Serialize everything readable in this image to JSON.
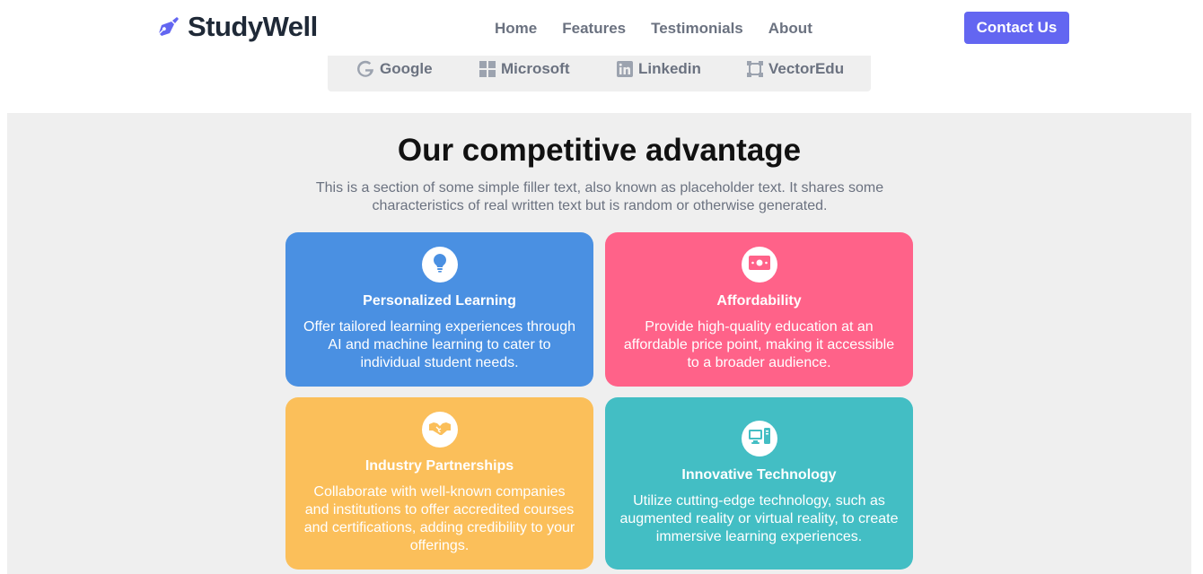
{
  "header": {
    "logo_text": "StudyWell",
    "nav": [
      "Home",
      "Features",
      "Testimonials",
      "About"
    ],
    "cta_label": "Contact Us"
  },
  "partners": [
    {
      "name": "Google",
      "icon": "google-icon"
    },
    {
      "name": "Microsoft",
      "icon": "microsoft-icon"
    },
    {
      "name": "Linkedin",
      "icon": "linkedin-icon"
    },
    {
      "name": "VectorEdu",
      "icon": "vector-icon"
    }
  ],
  "section": {
    "title": "Our competitive advantage",
    "subtitle": "This is a section of some simple filler text, also known as placeholder text. It shares some characteristics of real written text but is random or otherwise generated."
  },
  "cards": [
    {
      "title": "Personalized Learning",
      "text": "Offer tailored learning experiences through AI and machine learning to cater to individual student needs.",
      "icon": "lightbulb-icon",
      "color": "#4a90e2"
    },
    {
      "title": "Affordability",
      "text": "Provide high-quality education at an affordable price point, making it accessible to a broader audience.",
      "icon": "money-bill-icon",
      "color": "#ff6289"
    },
    {
      "title": "Industry Partnerships",
      "text": "Collaborate with well-known companies and institutions to offer accredited courses and certifications, adding credibility to your offerings.",
      "icon": "handshake-icon",
      "color": "#fbbf5a"
    },
    {
      "title": "Innovative Technology",
      "text": "Utilize cutting-edge technology, such as augmented reality or virtual reality, to create immersive learning experiences.",
      "icon": "computer-icon",
      "color": "#43bec4"
    }
  ],
  "colors": {
    "brand": "#6366f1",
    "section_bg": "#efefef"
  }
}
